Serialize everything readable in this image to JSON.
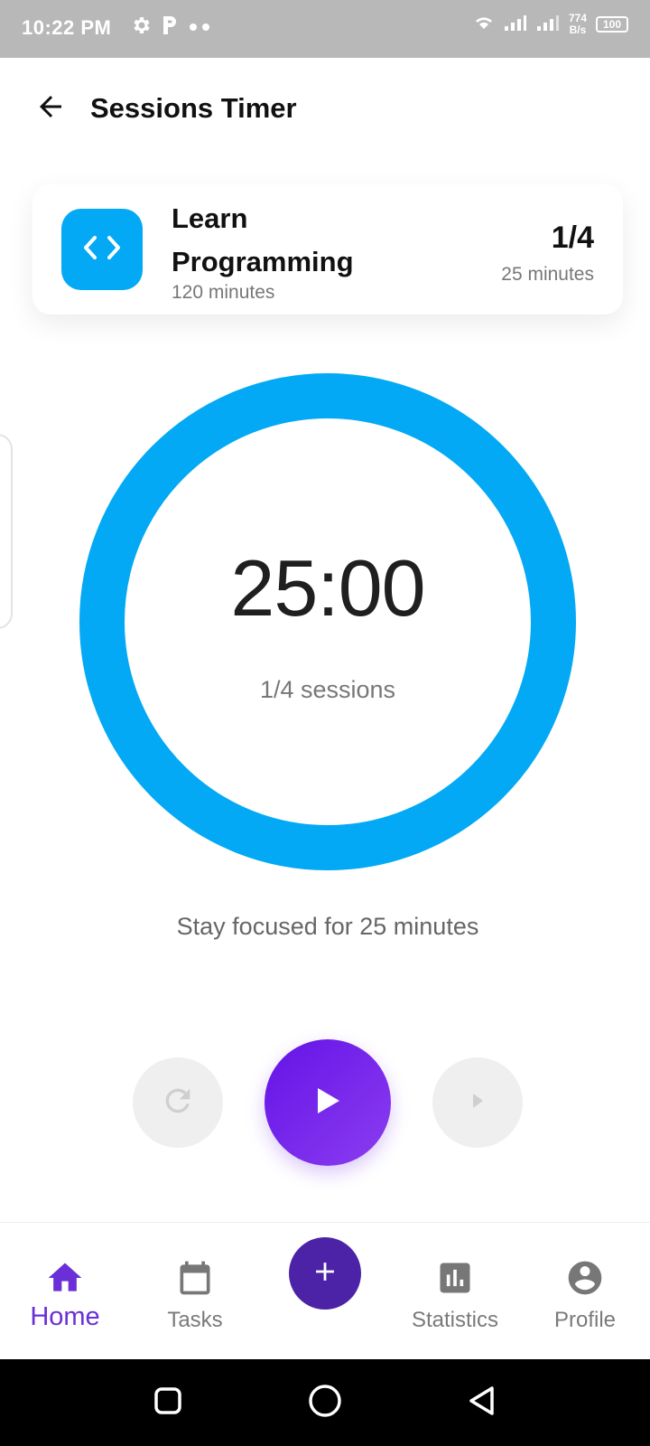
{
  "status_bar": {
    "time": "10:22 PM",
    "net_speed_value": "774",
    "net_speed_unit": "B/s",
    "battery": "100",
    "icons": [
      "gear-icon",
      "parking-icon",
      "more-dots-icon",
      "wifi-icon",
      "signal-icon",
      "signal-icon"
    ]
  },
  "header": {
    "title": "Sessions Timer",
    "back_icon": "arrow-left-icon"
  },
  "task_card": {
    "icon": "code-icon",
    "icon_color": "#03a9f4",
    "name": "Learn Programming",
    "duration": "120 minutes",
    "progress": "1/4",
    "session_length": "25 minutes"
  },
  "timer": {
    "time": "25:00",
    "sessions": "1/4 sessions",
    "ring_color": "#03a9f4",
    "focus_message": "Stay focused for 25 minutes"
  },
  "controls": {
    "reset_icon": "refresh-icon",
    "play_icon": "play-icon",
    "skip_icon": "skip-next-icon",
    "play_color": "#6a1de6"
  },
  "bottom_nav": {
    "active_color": "#6a2fd6",
    "items": [
      {
        "label": "Home",
        "icon": "home-icon",
        "active": true
      },
      {
        "label": "Tasks",
        "icon": "calendar-icon",
        "active": false
      },
      {
        "label": "",
        "icon": "plus-icon",
        "active": false
      },
      {
        "label": "Statistics",
        "icon": "bar-chart-icon",
        "active": false
      },
      {
        "label": "Profile",
        "icon": "account-circle-icon",
        "active": false
      }
    ]
  },
  "system_nav": {
    "buttons": [
      "recents-square-icon",
      "home-circle-icon",
      "back-triangle-icon"
    ]
  }
}
